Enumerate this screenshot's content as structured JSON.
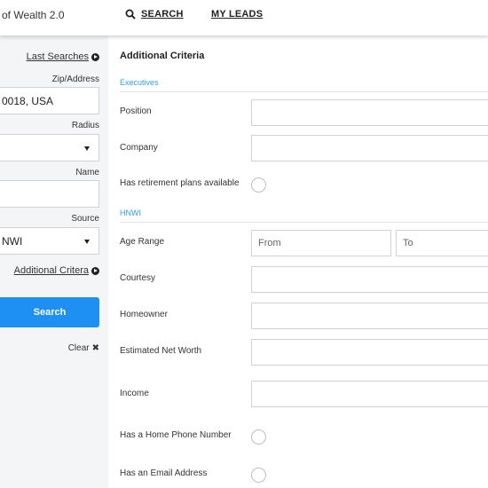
{
  "header": {
    "brand": "of Wealth 2.0",
    "nav": {
      "search": "SEARCH",
      "leads": "MY LEADS"
    }
  },
  "sidebar": {
    "last_searches": "Last Searches",
    "zip_label": "Zip/Address",
    "zip_value": "0018, USA",
    "radius_label": "Radius",
    "radius_value": "",
    "name_label": "Name",
    "name_value": "",
    "source_label": "Source",
    "source_value": "NWI",
    "additional_criteria_link": "Additional Critera",
    "search_button": "Search",
    "clear_label": "Clear",
    "clear_icon": "✖"
  },
  "main": {
    "title": "Additional Criteria",
    "sections": {
      "executives": "Executives",
      "hnwi": "HNWI"
    },
    "fields": {
      "position": "Position",
      "company": "Company",
      "retirement": "Has retirement plans available",
      "age_range": "Age Range",
      "age_from_placeholder": "From",
      "age_to_placeholder": "To",
      "courtesy": "Courtesy",
      "homeowner": "Homeowner",
      "net_worth": "Estimated Net Worth",
      "income": "Income",
      "home_phone": "Has a Home Phone Number",
      "email": "Has an Email Address"
    }
  },
  "colors": {
    "accent": "#1e90f3",
    "section": "#2aa3e5",
    "sidebar_bg": "#f4f5f7"
  }
}
